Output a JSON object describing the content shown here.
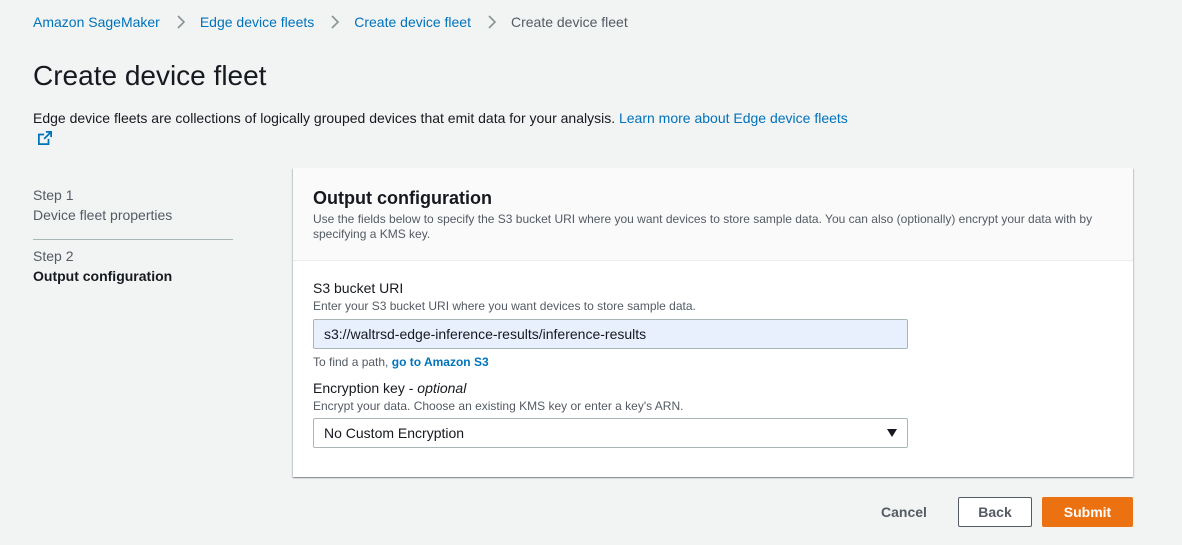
{
  "breadcrumb": {
    "items": [
      "Amazon SageMaker",
      "Edge device fleets",
      "Create device fleet"
    ],
    "current": "Create device fleet"
  },
  "page": {
    "title": "Create device fleet",
    "description": "Edge device fleets are collections of logically grouped devices that emit data for your analysis.",
    "learn_more": "Learn more about Edge device fleets"
  },
  "steps": [
    {
      "number": "Step 1",
      "label": "Device fleet properties"
    },
    {
      "number": "Step 2",
      "label": "Output configuration"
    }
  ],
  "panel": {
    "title": "Output configuration",
    "description": "Use the fields below to specify the S3 bucket URI where you want devices to store sample data. You can also (optionally) encrypt your data with by specifying a KMS key."
  },
  "s3_field": {
    "label": "S3 bucket URI",
    "description": "Enter your S3 bucket URI where you want devices to store sample data.",
    "value": "s3://waltrsd-edge-inference-results/inference-results",
    "hint_prefix": "To find a path,",
    "hint_link": "go to Amazon S3"
  },
  "encryption_field": {
    "label": "Encryption key",
    "optional": "optional",
    "description": "Encrypt your data. Choose an existing KMS key or enter a key's ARN.",
    "selected": "No Custom Encryption"
  },
  "actions": {
    "cancel": "Cancel",
    "back": "Back",
    "submit": "Submit"
  },
  "icons": {
    "separator": "chevron-right-icon",
    "external": "external-link-icon",
    "caret": "caret-down-icon"
  },
  "colors": {
    "link": "#0073bb",
    "primary": "#ec7211",
    "background": "#f2f3f3"
  }
}
